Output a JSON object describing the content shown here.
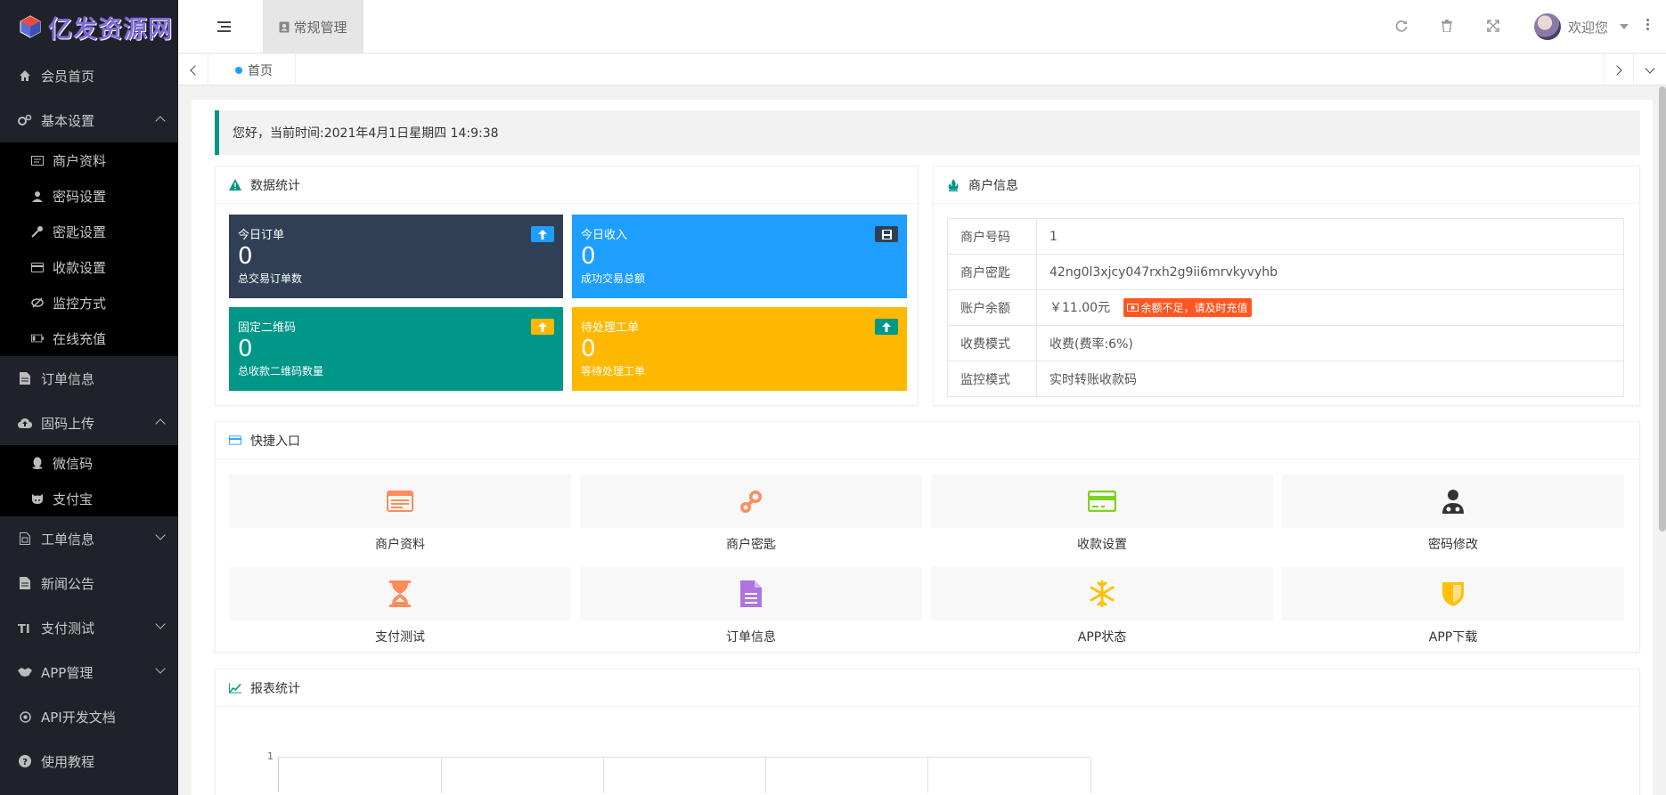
{
  "brand": {
    "name": "亿发资源网"
  },
  "sidebar": {
    "items": [
      {
        "label": "会员首页",
        "icon": "home-icon"
      },
      {
        "label": "基本设置",
        "icon": "gears-icon",
        "expanded": true,
        "children": [
          {
            "label": "商户资料",
            "icon": "id-card-icon"
          },
          {
            "label": "密码设置",
            "icon": "user-secret-icon"
          },
          {
            "label": "密匙设置",
            "icon": "key-icon"
          },
          {
            "label": "收款设置",
            "icon": "credit-card-icon"
          },
          {
            "label": "监控方式",
            "icon": "eye-slash-icon"
          },
          {
            "label": "在线充值",
            "icon": "battery-icon"
          }
        ]
      },
      {
        "label": "订单信息",
        "icon": "file-text-icon"
      },
      {
        "label": "固码上传",
        "icon": "cloud-upload-icon",
        "expanded": true,
        "children": [
          {
            "label": "微信码",
            "icon": "qq-icon"
          },
          {
            "label": "支付宝",
            "icon": "github-alt-icon"
          }
        ]
      },
      {
        "label": "工单信息",
        "icon": "file-sheet-icon",
        "expanded": false
      },
      {
        "label": "新闻公告",
        "icon": "file-icon"
      },
      {
        "label": "支付测试",
        "icon": "text-height-icon",
        "expanded": false
      },
      {
        "label": "APP管理",
        "icon": "handshake-icon",
        "expanded": false
      },
      {
        "label": "API开发文档",
        "icon": "dot-circle-icon"
      },
      {
        "label": "使用教程",
        "icon": "question-circle-icon"
      }
    ]
  },
  "header": {
    "tab_label": "常规管理",
    "welcome": "欢迎您"
  },
  "tabs": {
    "home": "首页"
  },
  "greeting": {
    "prefix": "您好，当前时间:",
    "time": "2021年4月1日星期四 14:9:38"
  },
  "stats": {
    "title": "数据统计",
    "cards": [
      {
        "label": "今日订单",
        "value": "0",
        "desc": "总交易订单数",
        "color": "#2f4056"
      },
      {
        "label": "今日收入",
        "value": "0",
        "desc": "成功交易总额",
        "color": "#1e9fff"
      },
      {
        "label": "固定二维码",
        "value": "0",
        "desc": "总收款二维码数量",
        "color": "#009688"
      },
      {
        "label": "待处理工单",
        "value": "0",
        "desc": "等待处理工单",
        "color": "#ffb800"
      }
    ]
  },
  "merchant": {
    "title": "商户信息",
    "rows": [
      {
        "key": "商户号码",
        "value": "1"
      },
      {
        "key": "商户密匙",
        "value": "42ng0l3xjcy047rxh2g9ii6mrvkyvyhb"
      },
      {
        "key": "账户余额",
        "value": "￥11.00元"
      },
      {
        "key": "收费模式",
        "value": "收费(费率:6%)"
      },
      {
        "key": "监控模式",
        "value": "实时转账收款码"
      }
    ],
    "balance_warning": "余额不足，请及时充值"
  },
  "quick": {
    "title": "快捷入口",
    "items": [
      {
        "label": "商户资料",
        "color": "#ff8c5a"
      },
      {
        "label": "商户密匙",
        "color": "#ff8c5a"
      },
      {
        "label": "收款设置",
        "color": "#7ed321"
      },
      {
        "label": "密码修改",
        "color": "#333333"
      },
      {
        "label": "支付测试",
        "color": "#ff8c5a"
      },
      {
        "label": "订单信息",
        "color": "#b074e0"
      },
      {
        "label": "APP状态",
        "color": "#ffc107"
      },
      {
        "label": "APP下载",
        "color": "#ffc107"
      }
    ]
  },
  "report": {
    "title": "报表统计",
    "y_tick": "1"
  }
}
